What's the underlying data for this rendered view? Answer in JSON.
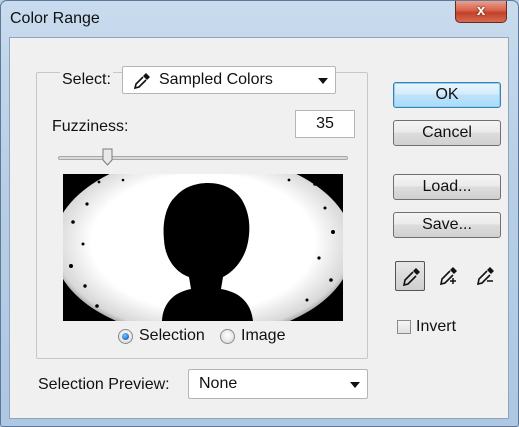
{
  "window": {
    "title": "Color Range",
    "close_glyph": "x"
  },
  "select": {
    "label": "Select:",
    "value": "Sampled Colors",
    "icon": "eyedropper-icon"
  },
  "fuzziness": {
    "label": "Fuzziness:",
    "value": "35",
    "slider_fraction": 0.17
  },
  "preview_mode": {
    "options": [
      {
        "label": "Selection",
        "selected": true
      },
      {
        "label": "Image",
        "selected": false
      }
    ]
  },
  "buttons": {
    "ok": "OK",
    "cancel": "Cancel",
    "load": "Load...",
    "save": "Save..."
  },
  "tools": [
    "eyedropper-icon",
    "eyedropper-plus-icon",
    "eyedropper-minus-icon"
  ],
  "invert": {
    "label": "Invert",
    "checked": false
  },
  "selection_preview": {
    "label": "Selection Preview:",
    "value": "None"
  },
  "colors": {
    "accent": "#3c7fb1",
    "close": "#c2412b",
    "frame": "#b8cfe6"
  }
}
